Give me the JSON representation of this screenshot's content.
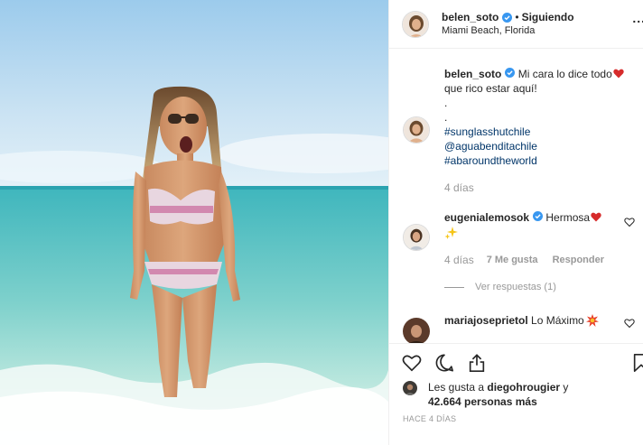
{
  "header": {
    "username": "belen_soto",
    "separator": "•",
    "follow_status": "Siguiendo",
    "location": "Miami Beach, Florida",
    "more_label": "..."
  },
  "caption": {
    "username": "belen_soto",
    "line1": "Mi cara lo dice todo",
    "line2": "que rico estar aquí!",
    "dot1": ".",
    "dot2": ".",
    "hashtags": [
      "#sunglasshutchile",
      "@aguabenditachile",
      "#abaroundtheworld"
    ],
    "time": "4 días"
  },
  "comments": [
    {
      "username": "eugenialemosok",
      "text": "Hermosa",
      "time": "4 días",
      "likes": "7 Me gusta",
      "reply_label": "Responder",
      "view_replies": "Ver respuestas (1)"
    },
    {
      "username": "mariajoseprietol",
      "text": "Lo Máximo"
    }
  ],
  "actions": {
    "like_icon": "heart-outline-icon",
    "comment_icon": "comment-icon",
    "share_icon": "share-icon",
    "save_icon": "bookmark-icon"
  },
  "likes": {
    "prefix": "Les gusta a ",
    "user": "diegohrougier",
    "suffix": " y",
    "count": "42.664 personas más"
  },
  "posted": "HACE 4 DÍAS",
  "colors": {
    "verified": "#3897f0",
    "heart": "#ed4956",
    "link": "#003569",
    "muted": "#999999"
  }
}
